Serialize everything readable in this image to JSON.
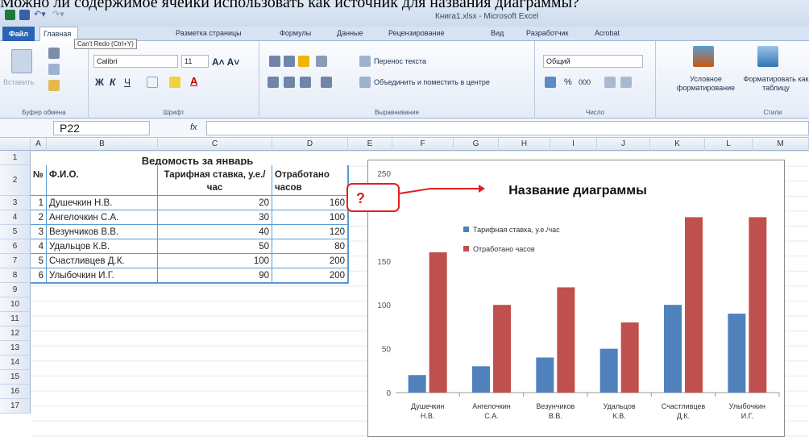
{
  "caption": "Можно ли содержимое ячейки использовать как источник для названия диаграммы?",
  "window": {
    "title": "Книга1.xlsx - Microsoft Excel"
  },
  "tabs": [
    {
      "label": "Файл"
    },
    {
      "label": "Главная"
    },
    {
      "label": "Разметка страницы"
    },
    {
      "label": "Формулы"
    },
    {
      "label": "Данные"
    },
    {
      "label": "Рецензирование"
    },
    {
      "label": "Вид"
    },
    {
      "label": "Разработчик"
    },
    {
      "label": "Acrobat"
    }
  ],
  "tooltip": "Can't Redo (Ctrl+Y)",
  "ribbon": {
    "paste_label": "Вставить",
    "clipboard_group": "Буфер обмена",
    "font_name": "Calibri",
    "font_size": "11",
    "font_group": "Шрифт",
    "wrap_text": "Перенос текста",
    "merge_center": "Объединить и поместить в центре",
    "alignment_group": "Выравнивание",
    "number_format": "Общий",
    "number_group": "Число",
    "percent": "%",
    "thousands": "000",
    "cond_format": "Условное форматирование",
    "format_table": "Форматировать как таблицу",
    "styles_group": "Стили",
    "bold": "Ж",
    "italic": "К",
    "underline": "Ч"
  },
  "formula_bar": {
    "name_box": "P22",
    "fx": "fx",
    "value": ""
  },
  "columns": [
    "A",
    "B",
    "C",
    "D",
    "E",
    "F",
    "G",
    "H",
    "I",
    "J",
    "K",
    "L",
    "M"
  ],
  "rows": [
    "1",
    "2",
    "3",
    "4",
    "5",
    "6",
    "7",
    "8",
    "9",
    "10",
    "11",
    "12",
    "13",
    "14",
    "15",
    "16",
    "17"
  ],
  "table": {
    "title": "Ведомость за январь",
    "headers": [
      "№",
      "Ф.И.О.",
      "Тарифная ставка, у.е./час",
      "Отработано часов"
    ],
    "rows": [
      {
        "n": "1",
        "name": "Душечкин Н.В.",
        "rate": "20",
        "hours": "160"
      },
      {
        "n": "2",
        "name": "Ангелочкин С.А.",
        "rate": "30",
        "hours": "100"
      },
      {
        "n": "3",
        "name": "Везунчиков В.В.",
        "rate": "40",
        "hours": "120"
      },
      {
        "n": "4",
        "name": "Удальцов К.В.",
        "rate": "50",
        "hours": "80"
      },
      {
        "n": "5",
        "name": "Счастливцев Д.К.",
        "rate": "100",
        "hours": "200"
      },
      {
        "n": "6",
        "name": "Улыбочкин И.Г.",
        "rate": "90",
        "hours": "200"
      }
    ]
  },
  "callout": "?",
  "colors": {
    "series1": "#4f81bd",
    "series2": "#c0504d",
    "callout": "#e21f1f",
    "accent": "#2a64b5"
  },
  "chart_data": {
    "type": "bar",
    "title": "Название диаграммы",
    "categories": [
      "Душечкин Н.В.",
      "Ангелочкин С.А.",
      "Везунчиков В.В.",
      "Удальцов К.В.",
      "Счастливцев Д.К.",
      "Улыбочкин И.Г."
    ],
    "series": [
      {
        "name": "Тарифная ставка, у.е./час",
        "values": [
          20,
          30,
          40,
          50,
          100,
          90
        ],
        "color": "#4f81bd"
      },
      {
        "name": "Отработано часов",
        "values": [
          160,
          100,
          120,
          80,
          200,
          200
        ],
        "color": "#c0504d"
      }
    ],
    "ylim": [
      0,
      250
    ],
    "yticks": [
      0,
      50,
      100,
      150,
      250
    ],
    "legend": "top-left",
    "grid": false
  }
}
